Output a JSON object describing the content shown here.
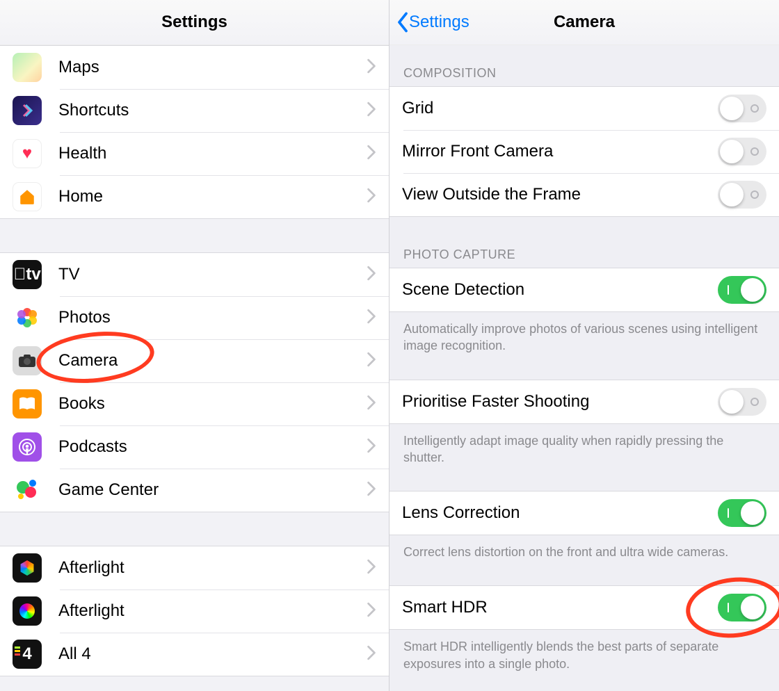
{
  "leftPane": {
    "title": "Settings",
    "groups": [
      {
        "id": "g1",
        "items": [
          {
            "icon": "maps",
            "label": "Maps"
          },
          {
            "icon": "shortcuts",
            "label": "Shortcuts"
          },
          {
            "icon": "health",
            "label": "Health"
          },
          {
            "icon": "home",
            "label": "Home"
          }
        ]
      },
      {
        "id": "g2",
        "items": [
          {
            "icon": "tv",
            "label": "TV"
          },
          {
            "icon": "photos",
            "label": "Photos"
          },
          {
            "icon": "camera",
            "label": "Camera",
            "highlighted": true
          },
          {
            "icon": "books",
            "label": "Books"
          },
          {
            "icon": "podcasts",
            "label": "Podcasts"
          },
          {
            "icon": "gamecenter",
            "label": "Game Center"
          }
        ]
      },
      {
        "id": "g3",
        "items": [
          {
            "icon": "afterlight",
            "label": "Afterlight"
          },
          {
            "icon": "afterlight2",
            "label": "Afterlight"
          },
          {
            "icon": "all4",
            "label": "All 4"
          }
        ]
      }
    ]
  },
  "rightPane": {
    "backLabel": "Settings",
    "title": "Camera",
    "sections": [
      {
        "header": "COMPOSITION",
        "rows": [
          {
            "label": "Grid",
            "toggle": false
          },
          {
            "label": "Mirror Front Camera",
            "toggle": false
          },
          {
            "label": "View Outside the Frame",
            "toggle": false
          }
        ]
      },
      {
        "header": "PHOTO CAPTURE",
        "rows": [
          {
            "label": "Scene Detection",
            "toggle": true,
            "footer": "Automatically improve photos of various scenes using intelligent image recognition."
          },
          {
            "label": "Prioritise Faster Shooting",
            "toggle": false,
            "footer": "Intelligently adapt image quality when rapidly pressing the shutter."
          },
          {
            "label": "Lens Correction",
            "toggle": true,
            "footer": "Correct lens distortion on the front and ultra wide cameras."
          },
          {
            "label": "Smart HDR",
            "toggle": true,
            "footer": "Smart HDR intelligently blends the best parts of separate exposures into a single photo.",
            "highlighted": true
          }
        ]
      }
    ]
  }
}
